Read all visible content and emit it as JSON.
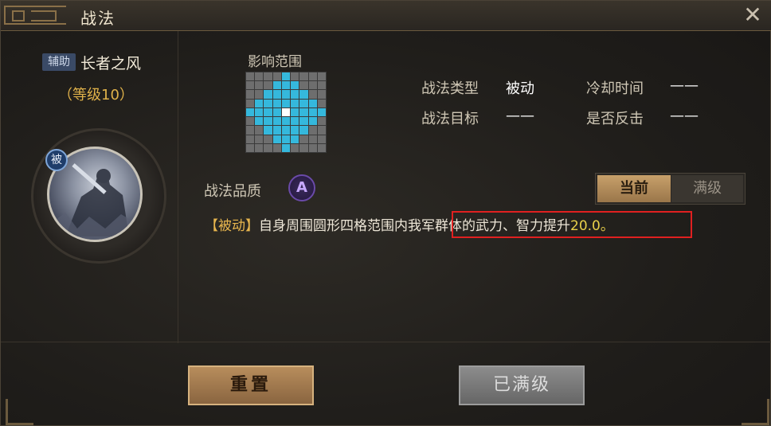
{
  "window": {
    "title": "战法",
    "close_glyph": "✕"
  },
  "tactic": {
    "role_tag": "辅助",
    "name": "长者之风",
    "level": "（等级10）",
    "passive_badge": "被"
  },
  "range": {
    "label": "影响范围",
    "grid_size": 9,
    "active_cells": [
      [
        0,
        4
      ],
      [
        1,
        3
      ],
      [
        1,
        4
      ],
      [
        1,
        5
      ],
      [
        2,
        2
      ],
      [
        2,
        3
      ],
      [
        2,
        4
      ],
      [
        2,
        5
      ],
      [
        2,
        6
      ],
      [
        3,
        1
      ],
      [
        3,
        2
      ],
      [
        3,
        3
      ],
      [
        3,
        4
      ],
      [
        3,
        5
      ],
      [
        3,
        6
      ],
      [
        3,
        7
      ],
      [
        4,
        0
      ],
      [
        4,
        1
      ],
      [
        4,
        2
      ],
      [
        4,
        3
      ],
      [
        4,
        5
      ],
      [
        4,
        6
      ],
      [
        4,
        7
      ],
      [
        4,
        8
      ],
      [
        5,
        1
      ],
      [
        5,
        2
      ],
      [
        5,
        3
      ],
      [
        5,
        4
      ],
      [
        5,
        5
      ],
      [
        5,
        6
      ],
      [
        5,
        7
      ],
      [
        6,
        2
      ],
      [
        6,
        3
      ],
      [
        6,
        4
      ],
      [
        6,
        5
      ],
      [
        6,
        6
      ],
      [
        7,
        3
      ],
      [
        7,
        4
      ],
      [
        7,
        5
      ],
      [
        8,
        4
      ]
    ],
    "center_cell": [
      4,
      4
    ],
    "colors": {
      "active": "#35b8dc",
      "inactive": "#6e6e6e",
      "center": "#ffffff"
    }
  },
  "info": {
    "type_label": "战法类型",
    "type_value": "被动",
    "cooldown_label": "冷却时间",
    "cooldown_value": "——",
    "target_label": "战法目标",
    "target_value": "——",
    "counter_label": "是否反击",
    "counter_value": "——"
  },
  "quality": {
    "label": "战法品质",
    "grade": "A",
    "toggle_current": "当前",
    "toggle_max": "满级"
  },
  "description": {
    "tag": "【被动】",
    "text_before": "自身周围圆形四格范围内",
    "text_highlight": "我军群体的武力、智力提升",
    "number": "20.0",
    "end": "。"
  },
  "buttons": {
    "reset": "重置",
    "maxed": "已满级"
  }
}
